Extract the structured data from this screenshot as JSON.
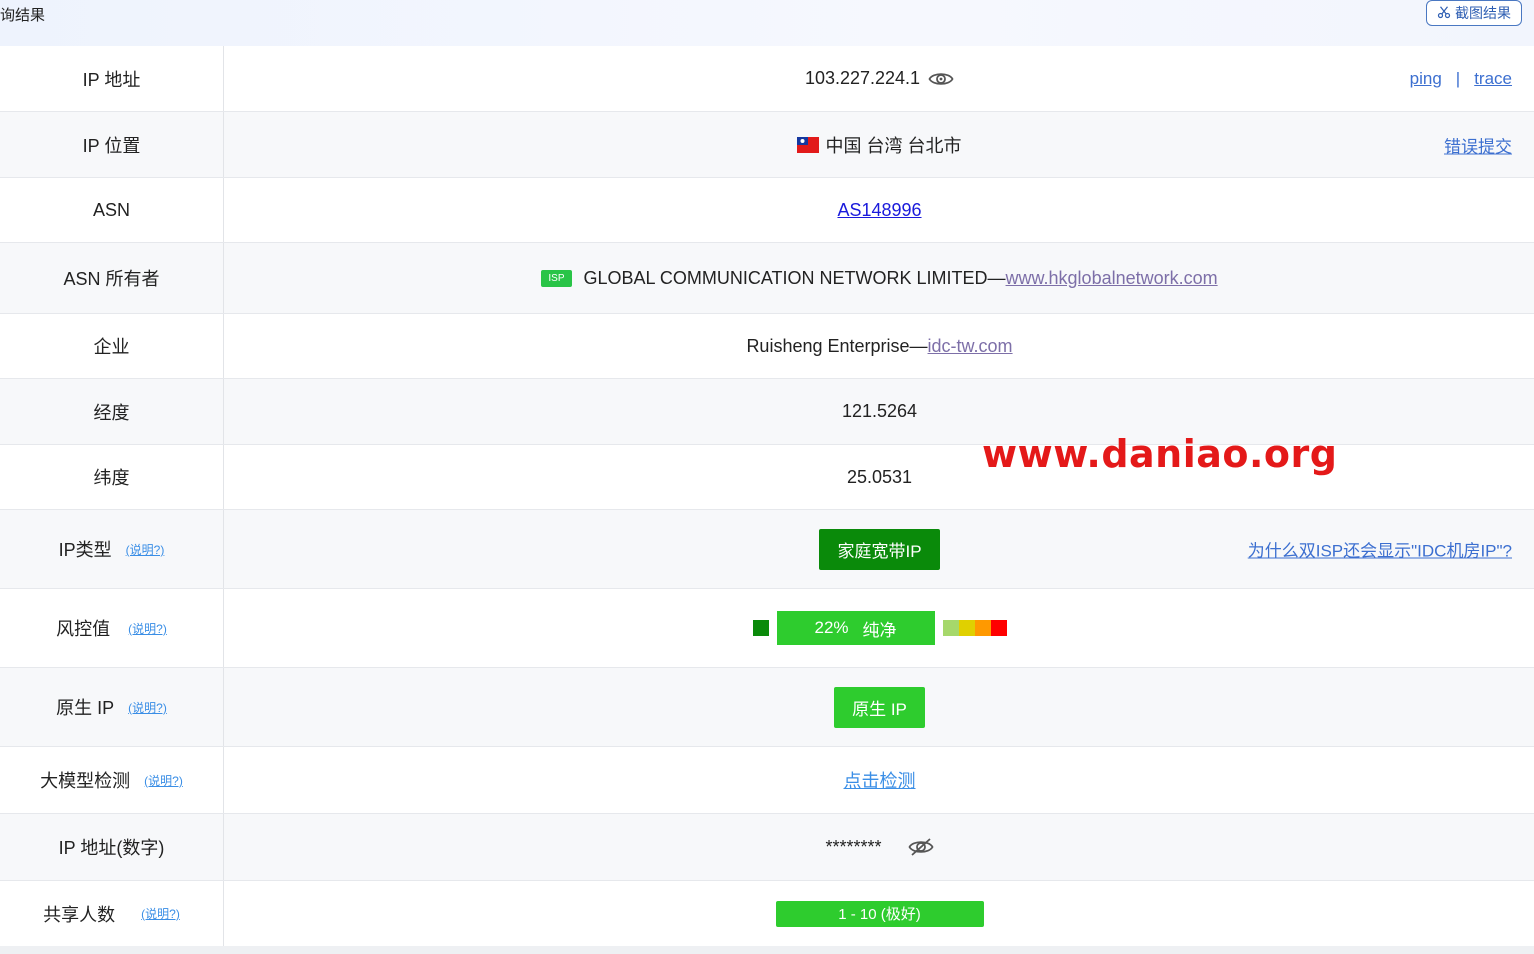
{
  "header": {
    "title": "询结果",
    "screenshot_button": "截图结果",
    "screenshot_icon": "scissors-icon"
  },
  "rows": {
    "ip": {
      "label": "IP 地址",
      "value": "103.227.224.1",
      "icon": "eye-icon",
      "ping": "ping",
      "sep": "|",
      "trace": "trace"
    },
    "location": {
      "label": "IP 位置",
      "flag": "🇹🇼",
      "value": "中国 台湾 台北市",
      "report": "错误提交"
    },
    "asn": {
      "label": "ASN",
      "value": "AS148996"
    },
    "asn_owner": {
      "label": "ASN 所有者",
      "badge": "ISP",
      "name": "GLOBAL COMMUNICATION NETWORK LIMITED—",
      "link": "www.hkglobalnetwork.com"
    },
    "enterprise": {
      "label": "企业",
      "name": "Ruisheng Enterprise—",
      "link": "idc-tw.com"
    },
    "longitude": {
      "label": "经度",
      "value": "121.5264"
    },
    "latitude": {
      "label": "纬度",
      "value": "25.0531"
    },
    "ip_type": {
      "label": "IP类型",
      "hint": "(说明?)",
      "value": "家庭宽带IP",
      "question": "为什么双ISP还会显示\"IDC机房IP\"?"
    },
    "risk": {
      "label": "风控值",
      "hint": "(说明?)",
      "percent": "22%",
      "status": "纯净",
      "level": 0.22,
      "scale_colors": [
        "#a6d86b",
        "#e0d000",
        "#ff9900",
        "#ff0000"
      ]
    },
    "native": {
      "label": "原生 IP",
      "hint": "(说明?)",
      "value": "原生 IP"
    },
    "llm": {
      "label": "大模型检测",
      "hint": "(说明?)",
      "value": "点击检测"
    },
    "ip_numeric": {
      "label": "IP 地址(数字)",
      "value": "********",
      "icon": "eye-off-icon"
    },
    "sharing": {
      "label": "共享人数",
      "hint": "(说明?)",
      "value": "1 - 10 (极好)"
    }
  },
  "watermark": "www.daniao.org",
  "colors": {
    "accent": "#3c6fd0",
    "green_dark": "#0a8a0a",
    "green_light": "#2ecc2e",
    "watermark": "#e41919"
  }
}
